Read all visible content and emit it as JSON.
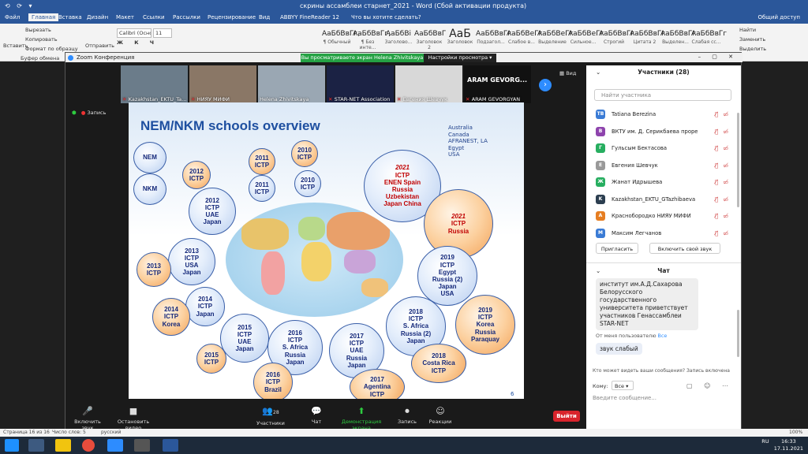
{
  "word": {
    "qa_icons": "⟲ ⟳ ▾",
    "doc_title": "скрины ассамблеи старнет_2021 - Word (Сбой активации продукта)",
    "tabs": [
      "Файл",
      "Главная",
      "Вставка",
      "Дизайн",
      "Макет",
      "Ссылки",
      "Рассылки",
      "Рецензирование",
      "Вид",
      "ABBYY FineReader 12",
      "Что вы хотите сделать?"
    ],
    "share": "Общий доступ",
    "ribbon_left": [
      "Вырезать",
      "Копировать",
      "Формат по образцу"
    ],
    "paste": "Вставить",
    "clipboard": "Буфер обмена",
    "send": "Отправить",
    "font_name": "Calibri (Осно",
    "font_size": "11",
    "styles": [
      {
        "sample": "АаБбВвГг,",
        "label": "¶ Обычный"
      },
      {
        "sample": "АаБбВвГг,",
        "label": "¶ Без инте..."
      },
      {
        "sample": "АаБбВі",
        "label": "Заголово..."
      },
      {
        "sample": "АаБбВвГ",
        "label": "Заголовок 2"
      },
      {
        "sample": "АаБ",
        "label": "Заголовок"
      },
      {
        "sample": "АаБбВвГг",
        "label": "Подзагол..."
      },
      {
        "sample": "АаБбВеГг",
        "label": "Слабое в..."
      },
      {
        "sample": "АаБбВеГг",
        "label": "Выделение"
      },
      {
        "sample": "АаБбВеГг",
        "label": "Сильное..."
      },
      {
        "sample": "АаБбВвГг",
        "label": "Строгий"
      },
      {
        "sample": "АаБбВвГг",
        "label": "Цитата 2"
      },
      {
        "sample": "АаБбВвГг",
        "label": "Выделен..."
      },
      {
        "sample": "АаБбВвГг",
        "label": "Слабая сс..."
      }
    ],
    "right_tools": [
      "Найти",
      "Заменить",
      "Выделить"
    ],
    "status": {
      "page": "Страница 16 из 16",
      "words": "Число слов: 5",
      "lang": "русский",
      "zoom": "100%"
    },
    "tray": {
      "lang": "RU",
      "time": "16:33",
      "date": "17.11.2021"
    }
  },
  "zoom": {
    "title": "Zoom Конференция",
    "sharing_banner": "Вы просматриваете экран Helena Zhivitskaya",
    "view_options": "Настройки просмотра ▾",
    "view_label": "Вид",
    "recording": "Запись",
    "thumbnails": [
      {
        "name": "Kazakhstan_EKTU_Ta...",
        "muted": true,
        "bg": "#6b7c8a"
      },
      {
        "name": "НИЯУ МИФИ",
        "muted": true,
        "bg": "#8a7766"
      },
      {
        "name": "Helena Zhivitskaya",
        "muted": false,
        "bg": "#9aa7b3"
      },
      {
        "name": "STAR-NET Association",
        "muted": true,
        "bg": "#1b2244"
      },
      {
        "name": "Евгения Шевчук",
        "muted": true,
        "bg": "#d8d8d8"
      },
      {
        "name": "ARAM GEVORGYAN",
        "muted": true,
        "bg": "#111111",
        "big": "ARAM GEVORG..."
      }
    ],
    "toolbar": [
      {
        "label": "Включить звук",
        "icon": "🎤"
      },
      {
        "label": "Остановить видео",
        "icon": "■"
      },
      {
        "label": "Участники",
        "icon": "👥",
        "count": "28"
      },
      {
        "label": "Чат",
        "icon": "💬"
      },
      {
        "label": "Демонстрация экрана",
        "icon": "⬆"
      },
      {
        "label": "Запись",
        "icon": "⏺"
      },
      {
        "label": "Реакции",
        "icon": "☺"
      }
    ],
    "leave": "Выйти"
  },
  "slide": {
    "title": "NEM/NKM schools overview",
    "countries": [
      "Australia",
      "Canada",
      "AFRANEST, LA",
      "Egypt",
      "USA"
    ],
    "slide_number": "6",
    "bubbles": [
      {
        "lines": [
          "NEM"
        ],
        "style": "blue"
      },
      {
        "lines": [
          "NKM"
        ],
        "style": "blue"
      },
      {
        "lines": [
          "2012",
          "ICTP"
        ],
        "style": "orange"
      },
      {
        "lines": [
          "2011",
          "ICTP"
        ],
        "style": "orange"
      },
      {
        "lines": [
          "2010",
          "ICTP"
        ],
        "style": "orange"
      },
      {
        "lines": [
          "2011",
          "ICTP"
        ],
        "style": "blue"
      },
      {
        "lines": [
          "2010",
          "ICTP"
        ],
        "style": "blue"
      },
      {
        "lines": [
          "2021",
          "ICTP",
          "ENEN  Spain",
          "Russia",
          "Uzbekistan",
          "Japan   China"
        ],
        "style": "blue",
        "red": true
      },
      {
        "lines": [
          "2012",
          "ICTP",
          "UAE",
          "Japan"
        ],
        "style": "blue"
      },
      {
        "lines": [
          "2021",
          "ICTP",
          "Russia"
        ],
        "style": "orange",
        "red": true
      },
      {
        "lines": [
          "2013",
          "ICTP",
          "USA",
          "Japan"
        ],
        "style": "blue"
      },
      {
        "lines": [
          "2013",
          "ICTP"
        ],
        "style": "orange"
      },
      {
        "lines": [
          "2019",
          "ICTP",
          "Egypt",
          "Russia (2)",
          "Japan",
          "USA"
        ],
        "style": "blue"
      },
      {
        "lines": [
          "2014",
          "ICTP",
          "Japan"
        ],
        "style": "blue"
      },
      {
        "lines": [
          "2014",
          "ICTP",
          "Korea"
        ],
        "style": "orange"
      },
      {
        "lines": [
          "2018",
          "ICTP",
          "S. Africa",
          "Russia (2)",
          "Japan"
        ],
        "style": "blue"
      },
      {
        "lines": [
          "2019",
          "ICTP",
          "Korea",
          "Russia",
          "Paraquay"
        ],
        "style": "orange"
      },
      {
        "lines": [
          "2015",
          "ICTP",
          "UAE",
          "Japan"
        ],
        "style": "blue"
      },
      {
        "lines": [
          "2016",
          "ICTP",
          "S. Africa",
          "Russia",
          "Japan"
        ],
        "style": "blue"
      },
      {
        "lines": [
          "2017",
          "ICTP",
          "UAE",
          "Russia",
          "Japan"
        ],
        "style": "blue"
      },
      {
        "lines": [
          "2015",
          "ICTP"
        ],
        "style": "orange"
      },
      {
        "lines": [
          "2018",
          "Costa Rica",
          "ICTP"
        ],
        "style": "orange"
      },
      {
        "lines": [
          "2016",
          "ICTP",
          "Brazil"
        ],
        "style": "orange"
      },
      {
        "lines": [
          "2017",
          "Agentina",
          "ICTP"
        ],
        "style": "orange"
      }
    ]
  },
  "participants": {
    "title": "Участники (28)",
    "search_placeholder": "Найти участника",
    "list": [
      {
        "initials": "TB",
        "name": "Tatiana Berezina",
        "color": "#3a7bd5"
      },
      {
        "initials": "B",
        "name": "ВКТУ им. Д. Серикбаева проректор п...",
        "color": "#8e44ad"
      },
      {
        "initials": "Г",
        "name": "Гульсым Бектасова",
        "color": "#27ae60"
      },
      {
        "initials": "Е",
        "name": "Евгения Шевчук",
        "color": "#999999"
      },
      {
        "initials": "Ж",
        "name": "Жанат Идрышева",
        "color": "#27ae60"
      },
      {
        "initials": "K",
        "name": "Kazakhstan_EKTU_GTazhibaeva",
        "color": "#2c3e50"
      },
      {
        "initials": "A",
        "name": "Краснобородко НИЯУ МИФИ",
        "color": "#e67e22"
      },
      {
        "initials": "M",
        "name": "Максим Легчанов",
        "color": "#3a7bd5"
      }
    ],
    "invite": "Пригласить",
    "unmute_self": "Включить свой звук"
  },
  "chat": {
    "title": "Чат",
    "message1": "институт им.А.Д.Сахарова Белорусского государственного университета приветствует участников Генассамблеи STAR-NET",
    "from_text": "От меня пользователю",
    "from_target": "Все",
    "message2": "звук слабый",
    "notice": "Кто может видеть ваши сообщения? Запись включена",
    "to_label": "Кому:",
    "to_value": "Все",
    "input_placeholder": "Введите сообщение..."
  }
}
